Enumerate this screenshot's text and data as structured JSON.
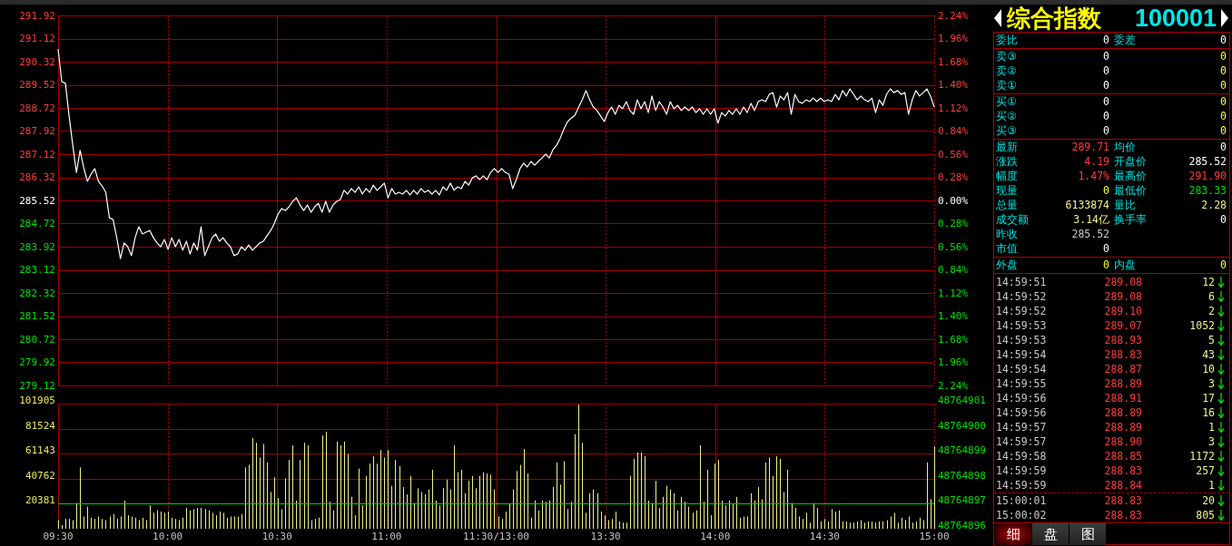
{
  "header": {
    "name": "综合指数",
    "code": "100001"
  },
  "price_chart": {
    "right_axis_labels": [
      "2.24%",
      "1.96%",
      "1.68%",
      "1.40%",
      "1.12%",
      "0.84%",
      "0.56%",
      "0.28%",
      "0.00%",
      "0.28%",
      "0.56%",
      "0.84%",
      "1.12%",
      "1.40%",
      "1.68%",
      "1.96%",
      "2.24%"
    ],
    "chart_data": {
      "type": "line",
      "grid": true,
      "ylim": [
        279.12,
        291.92
      ],
      "yticks": [
        279.12,
        279.92,
        280.72,
        281.52,
        282.32,
        283.12,
        283.92,
        284.72,
        285.52,
        286.32,
        287.12,
        287.92,
        288.72,
        289.52,
        290.32,
        291.12,
        291.92
      ],
      "series": [
        {
          "color": "#ffffff",
          "values": [
            290.76,
            289.63,
            289.57,
            288.44,
            287.43,
            286.49,
            287.25,
            286.65,
            286.18,
            286.43,
            286.62,
            286.18,
            286.02,
            285.8,
            284.92,
            284.86,
            284.23,
            283.51,
            284.05,
            283.92,
            283.61,
            284.23,
            284.61,
            284.36,
            284.42,
            284.48,
            284.23,
            284.05,
            283.92,
            284.17,
            283.83,
            284.23,
            283.92,
            284.17,
            283.8,
            284.11,
            283.67,
            284.05,
            283.8,
            284.61,
            283.61,
            283.92,
            284.23,
            284.36,
            284.11,
            284.23,
            284.05,
            283.92,
            283.61,
            283.67,
            283.92,
            283.8,
            283.98,
            283.8,
            283.92,
            284.05,
            284.11,
            284.3,
            284.48,
            284.73,
            285.05,
            285.24,
            285.17,
            285.3,
            285.49,
            285.61,
            285.36,
            285.17,
            285.36,
            285.11,
            285.3,
            285.42,
            285.11,
            285.49,
            285.11,
            285.36,
            285.49,
            285.55,
            285.87,
            285.74,
            285.93,
            285.8,
            285.99,
            285.74,
            285.93,
            285.8,
            286.05,
            285.87,
            285.99,
            286.12,
            285.61,
            285.93,
            285.74,
            285.8,
            285.74,
            285.87,
            285.71,
            285.87,
            285.74,
            285.93,
            285.8,
            285.87,
            285.74,
            285.87,
            285.71,
            285.99,
            285.87,
            286.12,
            285.87,
            285.99,
            285.93,
            286.18,
            286.05,
            286.3,
            286.37,
            286.24,
            286.37,
            286.24,
            286.49,
            286.62,
            286.49,
            286.62,
            286.49,
            286.43,
            285.93,
            286.24,
            286.62,
            286.81,
            286.68,
            286.87,
            286.74,
            286.87,
            286.99,
            287.12,
            286.99,
            287.28,
            287.43,
            287.68,
            288.0,
            288.25,
            288.37,
            288.47,
            288.75,
            289.0,
            289.32,
            289.0,
            288.75,
            288.63,
            288.44,
            288.25,
            288.56,
            288.75,
            288.5,
            288.81,
            288.69,
            288.94,
            288.63,
            288.5,
            289.0,
            288.69,
            288.94,
            288.56,
            289.13,
            288.63,
            288.94,
            288.75,
            288.5,
            288.94,
            288.69,
            288.81,
            288.63,
            288.75,
            288.63,
            288.75,
            288.56,
            288.69,
            288.5,
            288.69,
            288.5,
            288.69,
            288.19,
            288.56,
            288.44,
            288.63,
            288.5,
            288.69,
            288.5,
            288.75,
            288.56,
            288.88,
            288.63,
            288.94,
            289.0,
            288.94,
            289.19,
            289.25,
            288.75,
            289.13,
            289.0,
            289.25,
            288.5,
            289.19,
            288.94,
            288.88,
            289.0,
            288.94,
            289.06,
            288.94,
            289.06,
            288.94,
            289.0,
            288.94,
            289.19,
            289.0,
            289.32,
            289.13,
            289.38,
            289.19,
            289.0,
            289.13,
            289.0,
            288.94,
            289.06,
            288.56,
            289.0,
            288.81,
            289.19,
            289.38,
            289.25,
            289.32,
            289.19,
            289.25,
            288.5,
            289.0,
            289.32,
            289.13,
            289.25,
            289.38,
            289.13,
            288.75
          ]
        }
      ]
    }
  },
  "volume_chart": {
    "right_axis_labels": [
      "48764901",
      "48764900",
      "48764899",
      "48764898",
      "48764897",
      "48764896"
    ],
    "chart_data": {
      "type": "bar",
      "grid": true,
      "ylim": [
        0,
        101905
      ],
      "yticks": [
        20381,
        40762,
        61143,
        81524,
        101905
      ],
      "ref_lines": [
        {
          "axis": "y",
          "value": 20381
        }
      ],
      "series": [
        {
          "color": "#f0f08c",
          "values": [
            7000,
            3000,
            8000,
            8000,
            7000,
            21000,
            50000,
            10000,
            18000,
            9000,
            8000,
            10000,
            8000,
            7000,
            10000,
            12000,
            8000,
            10000,
            23000,
            11000,
            10000,
            9000,
            7000,
            9000,
            7000,
            19000,
            13000,
            15000,
            14000,
            13000,
            14000,
            9000,
            8000,
            7000,
            9000,
            17000,
            15000,
            16000,
            17000,
            17000,
            16000,
            15000,
            13000,
            11000,
            14000,
            13000,
            9000,
            10000,
            10000,
            10000,
            12000,
            50000,
            52000,
            74000,
            70000,
            58000,
            69000,
            54000,
            30000,
            42000,
            25000,
            16000,
            41000,
            56000,
            68000,
            23000,
            56000,
            70000,
            68000,
            7000,
            8000,
            9000,
            76000,
            79000,
            22000,
            15000,
            71000,
            68000,
            71000,
            61000,
            26000,
            11000,
            49000,
            19000,
            43000,
            53000,
            59000,
            53000,
            64000,
            58000,
            64000,
            35000,
            56000,
            51000,
            34000,
            28000,
            43000,
            21000,
            33000,
            30000,
            28000,
            32000,
            48000,
            23000,
            19000,
            33000,
            40000,
            32000,
            68000,
            46000,
            48000,
            29000,
            39000,
            43000,
            33000,
            43000,
            46000,
            45000,
            44000,
            32000,
            10000,
            8000,
            14000,
            20000,
            32000,
            47000,
            52000,
            65000,
            45000,
            9000,
            23000,
            15000,
            23000,
            22000,
            23000,
            34000,
            54000,
            36000,
            55000,
            16000,
            22000,
            77000,
            101000,
            70000,
            13000,
            29000,
            32000,
            29000,
            14000,
            11000,
            7000,
            8000,
            14000,
            6000,
            5000,
            5000,
            43000,
            57000,
            62000,
            62000,
            59000,
            23000,
            21000,
            39000,
            17000,
            26000,
            35000,
            32000,
            29000,
            15000,
            26000,
            22000,
            18000,
            13000,
            15000,
            68000,
            22000,
            48000,
            11000,
            53000,
            56000,
            23000,
            19000,
            23000,
            20000,
            26000,
            9000,
            10000,
            10000,
            29000,
            23000,
            34000,
            24000,
            54000,
            58000,
            43000,
            59000,
            57000,
            30000,
            48000,
            21000,
            17000,
            10000,
            8000,
            13000,
            5000,
            21000,
            17000,
            6000,
            8000,
            6000,
            16000,
            14000,
            15000,
            6000,
            6000,
            5000,
            5000,
            6000,
            7000,
            5000,
            6000,
            6000,
            5000,
            6000,
            6000,
            7000,
            10000,
            13000,
            5000,
            9000,
            7000,
            10000,
            5000,
            6000,
            9000,
            7000,
            54000,
            24000,
            67000
          ]
        }
      ]
    }
  },
  "time_axis": [
    "09:30",
    "10:00",
    "10:30",
    "11:00",
    "11:30/13:00",
    "13:30",
    "14:00",
    "14:30",
    "15:00"
  ],
  "quote": {
    "sections": [
      {
        "rows": [
          [
            {
              "label": "委比",
              "value": "0",
              "color": "#ffffff"
            },
            {
              "label": "委差",
              "value": "0",
              "color": "#ffffff"
            }
          ]
        ]
      },
      {
        "rows": [
          [
            {
              "label": "卖③",
              "value": "0",
              "color": "#ffffff"
            },
            {
              "value": "0",
              "color": "#ffff3c"
            }
          ],
          [
            {
              "label": "卖②",
              "value": "0",
              "color": "#ffffff"
            },
            {
              "value": "0",
              "color": "#ffff3c"
            }
          ],
          [
            {
              "label": "卖①",
              "value": "0",
              "color": "#ffffff"
            },
            {
              "value": "0",
              "color": "#ffff3c"
            }
          ]
        ]
      },
      {
        "rows": [
          [
            {
              "label": "买①",
              "value": "0",
              "color": "#ffffff"
            },
            {
              "value": "0",
              "color": "#ffff3c"
            }
          ],
          [
            {
              "label": "买②",
              "value": "0",
              "color": "#ffffff"
            },
            {
              "value": "0",
              "color": "#ffff3c"
            }
          ],
          [
            {
              "label": "买③",
              "value": "0",
              "color": "#ffffff"
            },
            {
              "value": "0",
              "color": "#ffff3c"
            }
          ]
        ]
      },
      {
        "rows": [
          [
            {
              "label": "最新",
              "value": "289.71",
              "color": "#ff3b3b"
            },
            {
              "label": "均价",
              "value": "0",
              "color": "#ffffff"
            }
          ],
          [
            {
              "label": "涨跌",
              "value": "4.19",
              "color": "#ff3b3b"
            },
            {
              "label": "开盘价",
              "value": "285.52",
              "color": "#ffffff"
            }
          ],
          [
            {
              "label": "幅度",
              "value": "1.47%",
              "color": "#ff3b3b"
            },
            {
              "label": "最高价",
              "value": "291.90",
              "color": "#ff3b3b"
            }
          ],
          [
            {
              "label": "现量",
              "value": "0",
              "color": "#ffff3c"
            },
            {
              "label": "最低价",
              "value": "283.33",
              "color": "#00dc00"
            }
          ],
          [
            {
              "label": "总量",
              "value": "6133874",
              "color": "#f0f08c"
            },
            {
              "label": "量比",
              "value": "2.28",
              "color": "#f0f08c"
            }
          ],
          [
            {
              "label": "成交额",
              "value": "3.14亿",
              "color": "#f0f08c"
            },
            {
              "label": "换手率",
              "value": "0",
              "color": "#ffffff"
            }
          ],
          [
            {
              "label": "昨收",
              "value": "285.52",
              "color": "#c8c8c8"
            }
          ],
          [
            {
              "label": "市值",
              "value": "0",
              "color": "#ffffff"
            }
          ]
        ]
      },
      {
        "rows": [
          [
            {
              "label": "外盘",
              "value": "0",
              "color": "#ffff3c"
            },
            {
              "label": "内盘",
              "value": "0",
              "color": "#ffff3c"
            }
          ]
        ]
      }
    ]
  },
  "trades": [
    {
      "time": "14:59:51",
      "price": "289.08",
      "volume": "12",
      "falling": true
    },
    {
      "time": "14:59:52",
      "price": "289.08",
      "volume": "6",
      "falling": true
    },
    {
      "time": "14:59:52",
      "price": "289.10",
      "volume": "2",
      "falling": true
    },
    {
      "time": "14:59:53",
      "price": "289.07",
      "volume": "1052",
      "falling": true
    },
    {
      "time": "14:59:53",
      "price": "288.93",
      "volume": "5",
      "falling": true
    },
    {
      "time": "14:59:54",
      "price": "288.83",
      "volume": "43",
      "falling": true
    },
    {
      "time": "14:59:54",
      "price": "288.87",
      "volume": "10",
      "falling": true
    },
    {
      "time": "14:59:55",
      "price": "288.89",
      "volume": "3",
      "falling": true
    },
    {
      "time": "14:59:56",
      "price": "288.91",
      "volume": "17",
      "falling": true
    },
    {
      "time": "14:59:56",
      "price": "288.89",
      "volume": "16",
      "falling": true
    },
    {
      "time": "14:59:57",
      "price": "288.89",
      "volume": "1",
      "falling": true
    },
    {
      "time": "14:59:57",
      "price": "288.90",
      "volume": "3",
      "falling": true
    },
    {
      "time": "14:59:58",
      "price": "288.85",
      "volume": "1172",
      "falling": true
    },
    {
      "time": "14:59:59",
      "price": "288.83",
      "volume": "257",
      "falling": true
    },
    {
      "time": "14:59:59",
      "price": "288.84",
      "volume": "1",
      "falling": true
    }
  ],
  "closing_trades": [
    {
      "time": "15:00:01",
      "price": "288.83",
      "volume": "20",
      "falling": true
    },
    {
      "time": "15:00:02",
      "price": "288.83",
      "volume": "805",
      "falling": true
    }
  ],
  "tabs": [
    {
      "label": "细",
      "selected": true
    },
    {
      "label": "盘",
      "selected": false
    },
    {
      "label": "图",
      "selected": false
    }
  ]
}
